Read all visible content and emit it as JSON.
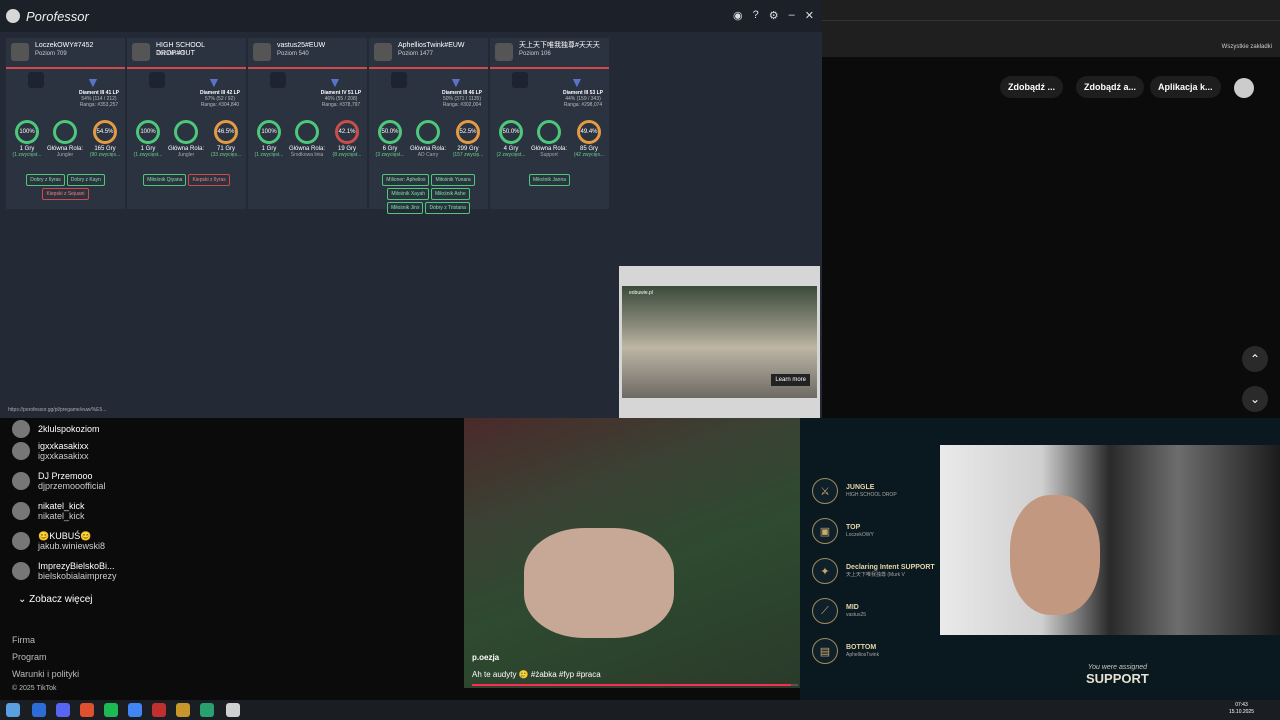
{
  "app": {
    "title": "Porofessor"
  },
  "players": [
    {
      "name": "LoczekOWY#7452",
      "level": "Poziom 709",
      "rank": "Diament III 41 LP",
      "winrate": "54% (114 / 212)",
      "ranga": "Ranga: #353,257",
      "s1": "100%",
      "s1b": "1 Gry",
      "s1c": "(1 zwycięst...",
      "role": "Jungler",
      "s3": "54.5%",
      "s3b": "165 Gry",
      "s3c": "(90 zwycięs...",
      "tags": [
        {
          "t": "Dobry z Ilyras",
          "bad": false
        },
        {
          "t": "Dobry z Kayn",
          "bad": false
        },
        {
          "t": "Kiepski z Sejuani",
          "bad": true
        }
      ]
    },
    {
      "name": "HIGH SCHOOL DROP#OUT",
      "level": "Poziom 43",
      "rank": "Diament III 42 LP",
      "winrate": "57% (52 / 92)",
      "ranga": "Ranga: #304,840",
      "s1": "100%",
      "s1b": "1 Gry",
      "s1c": "(1 zwycięst...",
      "role": "Jungler",
      "s3": "46.5%",
      "s3b": "71 Gry",
      "s3c": "(33 zwycięs...",
      "tags": [
        {
          "t": "Miłośnik Qiyana",
          "bad": false
        },
        {
          "t": "Kiepski z Ilyras",
          "bad": true
        }
      ]
    },
    {
      "name": "vastus25#EUW",
      "level": "Poziom 540",
      "rank": "Diament IV 51 LP",
      "winrate": "46% (55 / 208)",
      "ranga": "Ranga: #378,797",
      "s1": "100%",
      "s1b": "1 Gry",
      "s1c": "(1 zwycięst...",
      "role": "Środkowa linia",
      "s3": "42.1%",
      "s3b": "19 Gry",
      "s3c": "(8 zwycięst...",
      "tags": []
    },
    {
      "name": "AphelliosTwink#EUW",
      "level": "Poziom 1477",
      "rank": "Diament III 46 LP",
      "winrate": "50% (371 / 1135)",
      "ranga": "Ranga: #302,004",
      "s1": "50.0%",
      "s1b": "6 Gry",
      "s1c": "(3 zwycięst...",
      "role": "AD Carry",
      "s3": "52.5%",
      "s3b": "299 Gry",
      "s3c": "(157 zwycię...",
      "tags": [
        {
          "t": "Milioner: Aphelios",
          "bad": false
        },
        {
          "t": "Miłośnik Yunara",
          "bad": false
        },
        {
          "t": "Miłośnik Xayah",
          "bad": false
        },
        {
          "t": "Miłośnik Ashe",
          "bad": false
        },
        {
          "t": "Miłośnik Jinx",
          "bad": false
        },
        {
          "t": "Dobry z Tristana",
          "bad": false
        }
      ]
    },
    {
      "name": "天上天下唯我独尊#天天天",
      "level": "Poziom 106",
      "rank": "Diament III 53 LP",
      "winrate": "44% (159 / 343)",
      "ranga": "Ranga: #298,074",
      "s1": "50.0%",
      "s1b": "4 Gry",
      "s1c": "(2 zwycięst...",
      "role": "Support",
      "s3": "49.4%",
      "s3b": "85 Gry",
      "s3c": "(42 zwycięs...",
      "tags": [
        {
          "t": "Miłośnik Janna",
          "bad": false
        }
      ]
    }
  ],
  "labels": {
    "main_role": "Główna Rola:"
  },
  "status_url": "https://porofessor.gg/pl/pregame/euw/%E5...",
  "ad": {
    "learn": "Learn more",
    "brand": "eobuwie.pl"
  },
  "browser": {
    "bookmarks": "Wszystkie zakładki",
    "pill1": "Zdobądź ...",
    "pill2": "Zdobądź a...",
    "pill3": "Aplikacja k..."
  },
  "tiktok": {
    "accounts": [
      {
        "n1": "2klulspokoziom",
        "n2": ""
      },
      {
        "n1": "igxxkasakixx",
        "n2": "igxxkasakixx"
      },
      {
        "n1": "DJ Przemooo",
        "n2": "djprzemooofficial"
      },
      {
        "n1": "nikatel_kick",
        "n2": "nikatel_kick"
      },
      {
        "n1": "😊KUBUŚ😊",
        "n2": "jakub.winiewski8"
      },
      {
        "n1": "ImprezyBielskoBi...",
        "n2": "bielskobialaimprezy"
      }
    ],
    "more": "Zobacz więcej",
    "footer": [
      "Firma",
      "Program",
      "Warunki i polityki",
      "© 2025 TikTok"
    ]
  },
  "video": {
    "user": "p.oezja",
    "caption": "Ah te audyty 🥲 #żabka #fyp #praca",
    "progress": 0.98
  },
  "game": {
    "roles": [
      {
        "r1": "JUNGLE",
        "r2": "HIGH SCHOOL DROP"
      },
      {
        "r1": "TOP",
        "r2": "LoczekOWY"
      },
      {
        "r1": "Declaring Intent SUPPORT",
        "r2": "天上天下唯我独尊 (Murk V"
      },
      {
        "r1": "MID",
        "r2": "vastus25"
      },
      {
        "r1": "BOTTOM",
        "r2": "AphelliosTwink"
      }
    ],
    "assigned1": "You were assigned",
    "assigned2": "SUPPORT"
  },
  "clock": {
    "time": "07:43",
    "date": "15.10.2025"
  }
}
